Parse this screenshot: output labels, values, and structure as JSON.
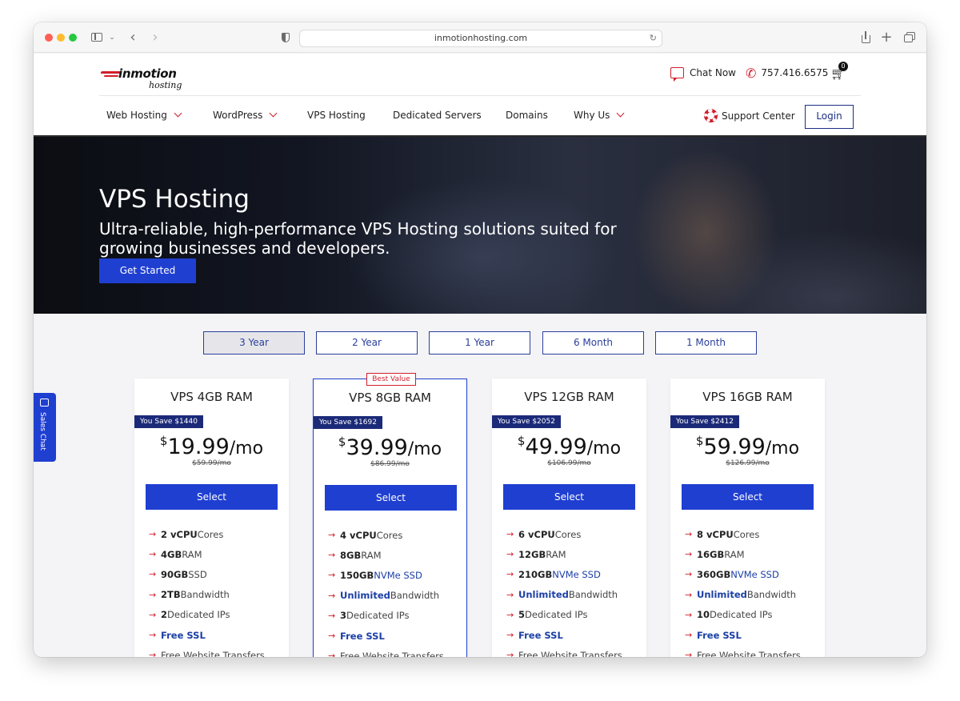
{
  "browser": {
    "url": "inmotionhosting.com"
  },
  "header": {
    "logo_word": "inmotion",
    "logo_sub": "hosting",
    "chat_label": "Chat Now",
    "phone": "757.416.6575",
    "cart_count": "0"
  },
  "nav": {
    "items": [
      {
        "label": "Web Hosting",
        "dropdown": true
      },
      {
        "label": "WordPress",
        "dropdown": true
      },
      {
        "label": "VPS Hosting",
        "dropdown": false
      },
      {
        "label": "Dedicated Servers",
        "dropdown": false
      },
      {
        "label": "Domains",
        "dropdown": false
      },
      {
        "label": "Why Us",
        "dropdown": true
      }
    ],
    "support_label": "Support Center",
    "login_label": "Login"
  },
  "hero": {
    "title": "VPS Hosting",
    "subtitle": "Ultra-reliable, high-performance VPS Hosting solutions suited for growing businesses and developers.",
    "cta": "Get Started"
  },
  "sales_chat": "Sales Chat",
  "terms": [
    "3 Year",
    "2 Year",
    "1 Year",
    "6 Month",
    "1 Month"
  ],
  "active_term": "3 Year",
  "plans": [
    {
      "name": "VPS 4GB RAM",
      "savings": "You Save $1440",
      "currency": "$",
      "price": "19.99",
      "unit": "/mo",
      "old_price": "$59.99/mo",
      "select": "Select",
      "featured": false,
      "features": [
        {
          "strong": "2 vCPU",
          "rest": " Cores"
        },
        {
          "strong": "4GB",
          "rest": " RAM"
        },
        {
          "strong": "90GB",
          "rest": " SSD"
        },
        {
          "strong": "2TB",
          "rest": " Bandwidth"
        },
        {
          "strong": "2",
          "rest": " Dedicated IPs"
        },
        {
          "hl": "Free SSL"
        },
        {
          "plain": "Free Website Transfers"
        }
      ]
    },
    {
      "name": "VPS 8GB RAM",
      "badge": "Best Value",
      "savings": "You Save $1692",
      "currency": "$",
      "price": "39.99",
      "unit": "/mo",
      "old_price": "$86.99/mo",
      "select": "Select",
      "featured": true,
      "features": [
        {
          "strong": "4 vCPU",
          "rest": " Cores"
        },
        {
          "strong": "8GB",
          "rest": " RAM"
        },
        {
          "strong": "150GB",
          "hl_n": " NVMe SSD"
        },
        {
          "hl": "Unlimited",
          "rest": " Bandwidth"
        },
        {
          "strong": "3",
          "rest": " Dedicated IPs"
        },
        {
          "hl": "Free SSL"
        },
        {
          "plain": "Free Website Transfers"
        }
      ]
    },
    {
      "name": "VPS 12GB RAM",
      "savings": "You Save $2052",
      "currency": "$",
      "price": "49.99",
      "unit": "/mo",
      "old_price": "$106.99/mo",
      "select": "Select",
      "featured": false,
      "features": [
        {
          "strong": "6 vCPU",
          "rest": " Cores"
        },
        {
          "strong": "12GB",
          "rest": " RAM"
        },
        {
          "strong": "210GB",
          "hl_n": " NVMe SSD"
        },
        {
          "hl": "Unlimited",
          "rest": " Bandwidth"
        },
        {
          "strong": "5",
          "rest": " Dedicated IPs"
        },
        {
          "hl": "Free SSL"
        },
        {
          "plain": "Free Website Transfers"
        }
      ]
    },
    {
      "name": "VPS 16GB RAM",
      "savings": "You Save $2412",
      "currency": "$",
      "price": "59.99",
      "unit": "/mo",
      "old_price": "$126.99/mo",
      "select": "Select",
      "featured": false,
      "features": [
        {
          "strong": "8 vCPU",
          "rest": " Cores"
        },
        {
          "strong": "16GB",
          "rest": " RAM"
        },
        {
          "strong": "360GB",
          "hl_n": " NVMe SSD"
        },
        {
          "hl": "Unlimited",
          "rest": " Bandwidth"
        },
        {
          "strong": "10",
          "rest": " Dedicated IPs"
        },
        {
          "hl": "Free SSL"
        },
        {
          "plain": "Free Website Transfers"
        }
      ]
    }
  ],
  "colors": {
    "brand_red": "#d01e2b",
    "brand_blue": "#1f3fd1",
    "navy": "#1b2a78"
  }
}
